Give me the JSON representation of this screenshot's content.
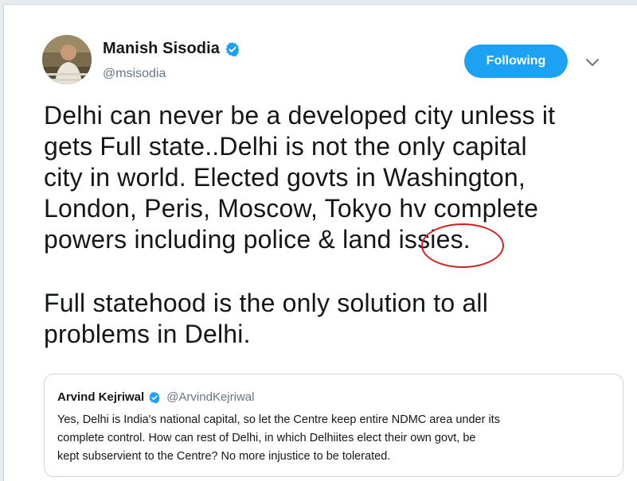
{
  "author": {
    "name": "Manish Sisodia",
    "handle": "@msisodia",
    "verified_icon": "verified-badge-icon",
    "avatar_icon": "user-avatar"
  },
  "actions": {
    "follow_label": "Following",
    "menu_icon": "chevron-down-icon"
  },
  "tweet": {
    "lines": [
      "Delhi can never be a developed city unless it",
      "gets Full state..Delhi is not the only capital",
      "city in world. Elected govts in Washington,",
      "London, Peris, Moscow, Tokyo hv complete",
      "powers including police & land issies."
    ],
    "lines2": [
      "Full statehood is the only solution to all",
      "problems in Delhi."
    ]
  },
  "quoted_tweet": {
    "name": "Arvind Kejriwal",
    "handle": "@ArvindKejriwal",
    "lines": [
      "Yes, Delhi is India's national capital, so let the Centre keep entire NDMC area under its",
      "complete control. How can rest of Delhi, in which Delhiites elect their own govt, be",
      "kept subservient to the Centre? No more injustice to be tolerated."
    ]
  },
  "colors": {
    "accent": "#1da1f2",
    "highlight_circle": "#d11f1f",
    "text_primary": "#14171a",
    "text_secondary": "#657786"
  }
}
